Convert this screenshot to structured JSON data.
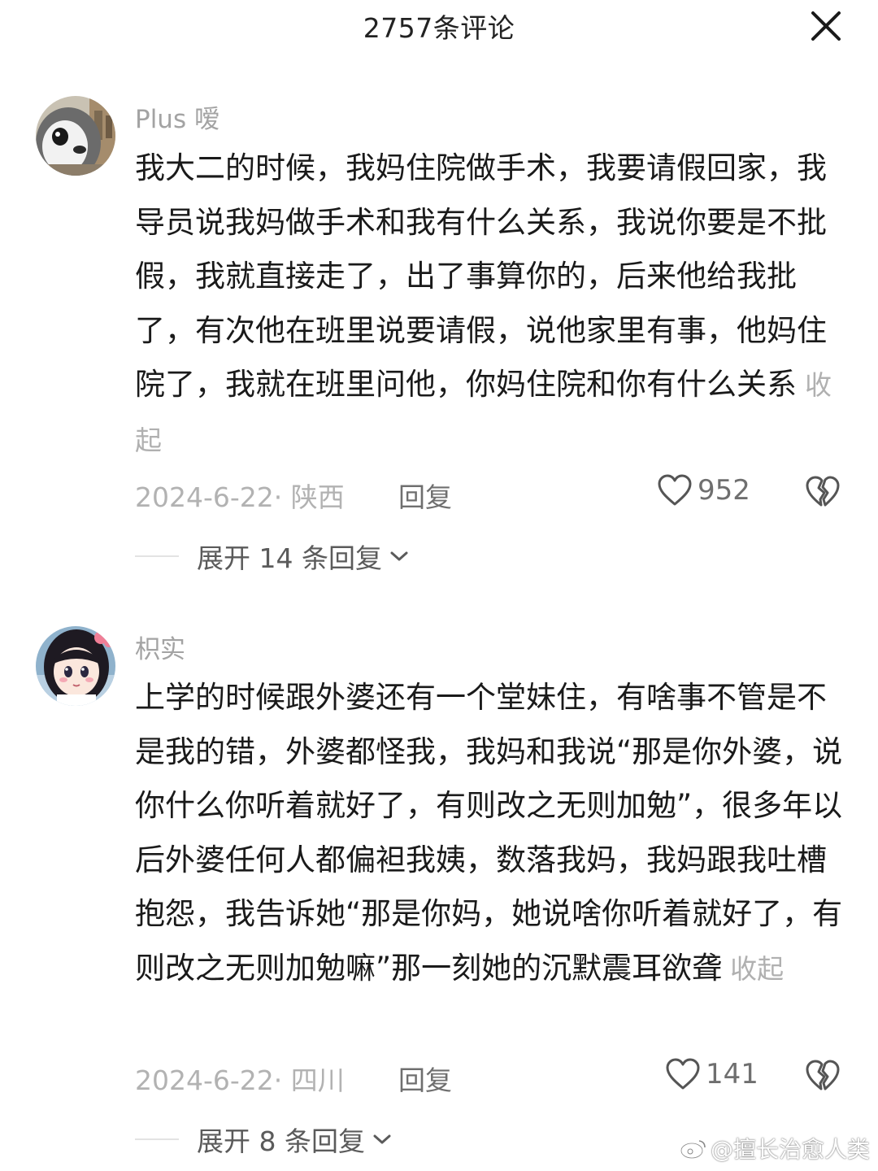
{
  "header": {
    "title": "2757条评论"
  },
  "comments": [
    {
      "username": "Plus 嗳",
      "text": "我大二的时候，我妈住院做手术，我要请假回家，我导员说我妈做手术和我有什么关系，我说你要是不批假，我就直接走了，出了事算你的，后来他给我批了，有次他在班里说要请假，说他家里有事，他妈住院了，我就在班里问他，你妈住院和你有什么关系",
      "collapse": "收起",
      "date_location": "2024-6-22· 陕西",
      "reply": "回复",
      "likes": "952",
      "expand": "展开 14 条回复"
    },
    {
      "username": "枳实",
      "text": "上学的时候跟外婆还有一个堂妹住，有啥事不管是不是我的错，外婆都怪我，我妈和我说“那是你外婆，说你什么你听着就好了，有则改之无则加勉”，很多年以后外婆任何人都偏袒我姨，数落我妈，我妈跟我吐槽抱怨，我告诉她“那是你妈，她说啥你听着就好了，有则改之无则加勉嘛”那一刻她的沉默震耳欲聋",
      "collapse": "收起",
      "date_location": "2024-6-22· 四川",
      "reply": "回复",
      "likes": "141",
      "expand": "展开 8 条回复"
    }
  ],
  "watermark": "@擅长治愈人类",
  "icons": {
    "close": "close-icon",
    "like": "heart-icon",
    "dislike": "broken-heart-icon",
    "expand": "chevron-down-icon",
    "watermark": "weibo-icon"
  }
}
